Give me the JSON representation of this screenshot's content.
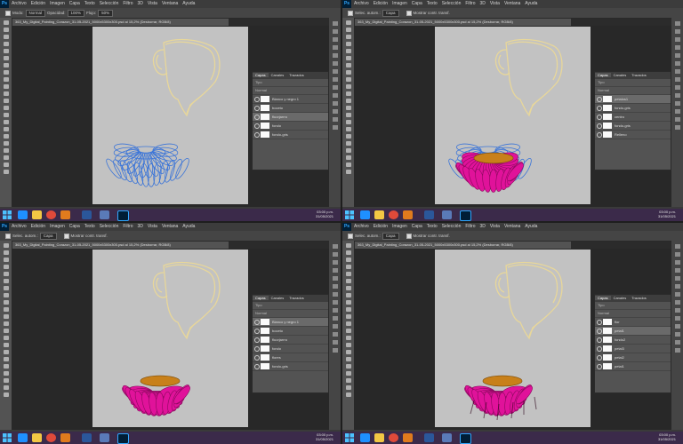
{
  "app": {
    "logo": "Ps",
    "menus": [
      "Archivo",
      "Edición",
      "Imagen",
      "Capa",
      "Texto",
      "Selección",
      "Filtro",
      "3D",
      "Vista",
      "Ventana",
      "Ayuda"
    ]
  },
  "options": {
    "mode_label": "Modo:",
    "mode_value": "Normal",
    "opacity_label": "Opacidad:",
    "opacity_value": "100%",
    "flow_label": "Flujo:",
    "flow_value": "50%"
  },
  "options_move": {
    "auto_select": "Selec. autom.:",
    "target": "Capa",
    "show_transform": "Mostrar contr. transf."
  },
  "document": {
    "tab": "363_My_Digital_Painting_Corazon_31-05-2021_5000x5300x300.psd al 15,2% (Desborrar, RGB/8)",
    "status": "Doc: 75,8 M/463,7 M",
    "zoom": "15,2%"
  },
  "layers_panel": {
    "tabs": [
      "Capas",
      "Canales",
      "Trazados"
    ],
    "kind": "Tipo",
    "blend": "Normal",
    "opacity": "100%",
    "lock": "Bloq.:",
    "fill": "Relleno: 100%"
  },
  "quadrants": [
    {
      "layers": [
        "Blanco y negro 1",
        "boceto",
        "fluorjarrro",
        "fondo",
        "fondo-gris"
      ],
      "selected": 2
    },
    {
      "layers": [
        "petalos1",
        "fondo-gris",
        "centro",
        "fondo-gris",
        "Relleno"
      ],
      "selected": 0
    },
    {
      "layers": [
        "Blanco y negro 1",
        "boceto",
        "fluorjarrro",
        "fondo",
        "flores",
        "fondo-gris"
      ],
      "selected": 0
    },
    {
      "layers": [
        "flor",
        "petal1",
        "fondo2",
        "petal3",
        "petal2",
        "petal1"
      ],
      "selected": 1
    }
  ],
  "taskbar": {
    "time": "03:00 p.m.",
    "date": "31/05/2021"
  },
  "colors": {
    "petal": "#e0129a",
    "petal_dark": "#8a0a5e",
    "center": "#c8801a",
    "sketch_blue": "#3a74d8",
    "jar_line": "#e8d79a",
    "canvas": "#c2c2c2"
  },
  "icons": [
    "photoshop-logo",
    "move-tool-icon",
    "brush-tool-icon",
    "eye-icon",
    "lock-icon",
    "windows-start-icon",
    "chrome-icon",
    "word-icon",
    "photoshop-taskbar-icon"
  ]
}
